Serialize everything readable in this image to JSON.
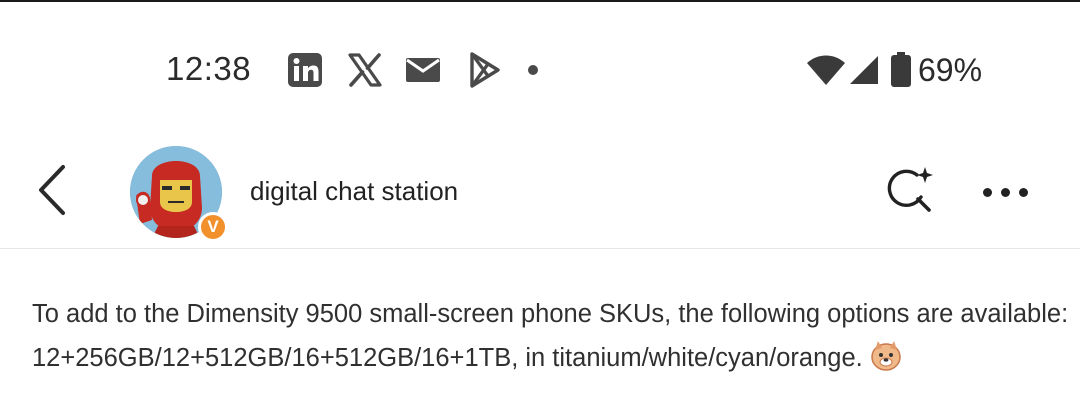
{
  "status_bar": {
    "time": "12:38",
    "notification_icons": [
      "linkedin-icon",
      "x-icon",
      "mail-icon",
      "play-store-icon",
      "more-notifications-dot"
    ],
    "battery_percent": "69%"
  },
  "header": {
    "back_icon": "chevron-left-icon",
    "channel_name": "digital chat station",
    "verified_badge": "V",
    "actions": [
      "ai-search-icon",
      "more-options-icon"
    ]
  },
  "post": {
    "line1": "To add to the Dimensity 9500 small-screen phone SKUs, the following options are available:",
    "line2": "12+256GB/12+512GB/16+512GB/16+1TB, in titanium/white/cyan/orange."
  },
  "colors": {
    "badge": "#f2902c",
    "text": "#303030",
    "divider": "#e6e6e6"
  }
}
